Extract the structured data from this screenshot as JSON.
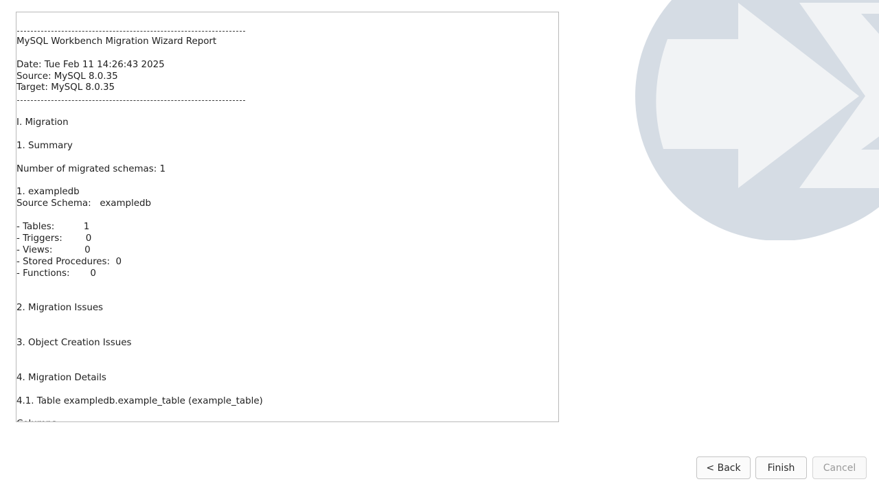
{
  "report": {
    "lines": [
      "---",
      "MySQL Workbench Migration Wizard Report",
      "",
      "Date: Tue Feb 11 14:26:43 2025",
      "Source: MySQL 8.0.35",
      "Target: MySQL 8.0.35",
      "---",
      "",
      "I. Migration",
      "",
      "1. Summary",
      "",
      "Number of migrated schemas: 1",
      "",
      "1. exampledb",
      "Source Schema:   exampledb",
      "",
      "- Tables:          1",
      "- Triggers:        0",
      "- Views:           0",
      "- Stored Procedures:  0",
      "- Functions:       0",
      "",
      "",
      "2. Migration Issues",
      "",
      "",
      "3. Object Creation Issues",
      "",
      "",
      "4. Migration Details",
      "",
      "4.1. Table exampledb.example_table (example_table)",
      "",
      "Columns:"
    ]
  },
  "buttons": {
    "back": "< Back",
    "finish": "Finish",
    "cancel": "Cancel"
  },
  "logo": {
    "icon": "migration-arrow-logo-icon",
    "circle_color": "#d5dce4",
    "arrow_color": "#f1f3f5"
  }
}
